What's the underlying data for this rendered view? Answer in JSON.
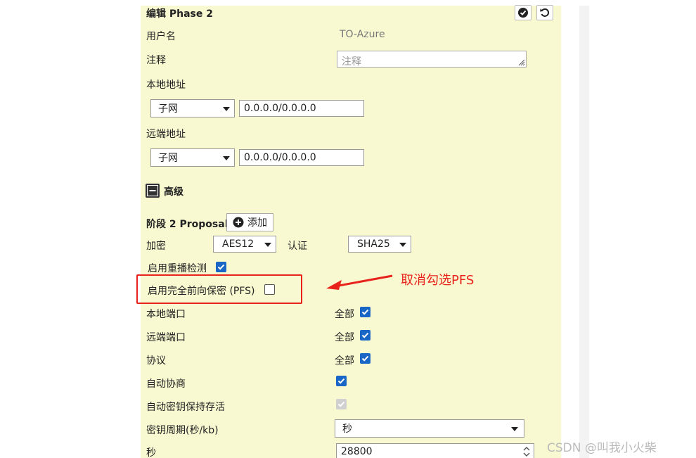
{
  "header": {
    "title": "编辑 Phase 2"
  },
  "fields": {
    "username_label": "用户名",
    "username_value": "TO-Azure",
    "comment_label": "注释",
    "comment_placeholder": "注释",
    "local_addr_label": "本地地址",
    "local_addr_type": "子网",
    "local_addr_value": "0.0.0.0/0.0.0.0",
    "remote_addr_label": "远端地址",
    "remote_addr_type": "子网",
    "remote_addr_value": "0.0.0.0/0.0.0.0"
  },
  "advanced": {
    "label": "高级",
    "proposal_label": "阶段 2 Proposal",
    "add_label": "添加",
    "encryption_label": "加密",
    "encryption_value": "AES12",
    "auth_label": "认证",
    "auth_value": "SHA25",
    "replay_label": "启用重播检测",
    "replay_checked": true,
    "pfs_label": "启用完全前向保密 (PFS)",
    "pfs_checked": false,
    "local_port_label": "本地端口",
    "local_port_all": "全部",
    "remote_port_label": "远端端口",
    "remote_port_all": "全部",
    "protocol_label": "协议",
    "protocol_all": "全部",
    "autonegotiate_label": "自动协商",
    "keepalive_label": "自动密钥保持存活",
    "key_lifetime_label": "密钥周期(秒/kb)",
    "key_lifetime_value": "秒",
    "seconds_label": "秒",
    "seconds_value": "28800"
  },
  "annotation": {
    "text": "取消勾选PFS",
    "color": "#e8231c"
  },
  "watermark": "CSDN @叫我小火柴",
  "colors": {
    "panel_bg": "#f8f9d0",
    "checkbox": "#1a66c7",
    "annotation": "#e8231c"
  }
}
